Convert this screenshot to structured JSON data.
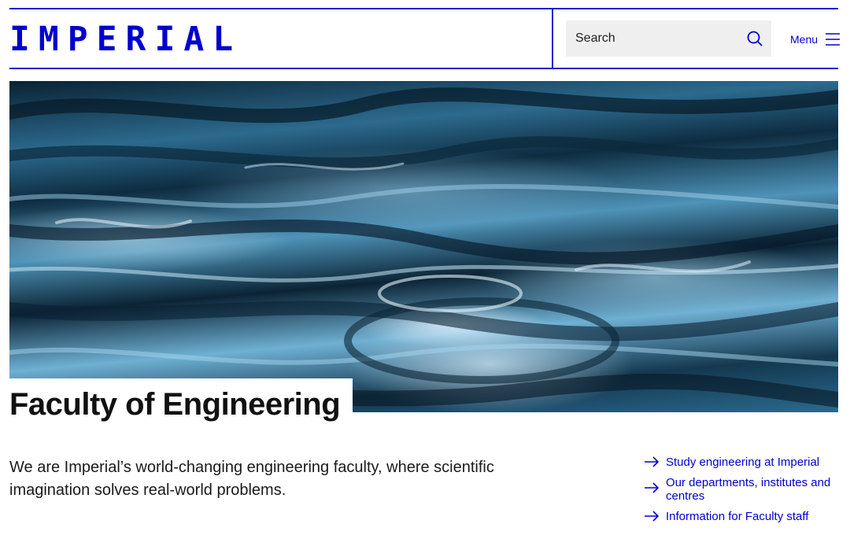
{
  "header": {
    "logo_text": "IMPERIAL",
    "search": {
      "placeholder": "Search",
      "value": ""
    },
    "menu_label": "Menu"
  },
  "hero": {
    "image_description_icon": "water-surface-image",
    "title": "Faculty of Engineering"
  },
  "intro": {
    "text": "We are Imperial’s world-changing engineering faculty, where scientific imagination solves real-world problems."
  },
  "quick_links": [
    {
      "label": "Study engineering at Imperial",
      "icon": "arrow-right-icon"
    },
    {
      "label": "Our departments, institutes and centres",
      "icon": "arrow-right-icon"
    },
    {
      "label": "Information for Faculty staff",
      "icon": "arrow-right-icon"
    }
  ],
  "colors": {
    "brand_blue": "#0000cd",
    "search_bg": "#efefef",
    "text_dark": "#111111"
  }
}
